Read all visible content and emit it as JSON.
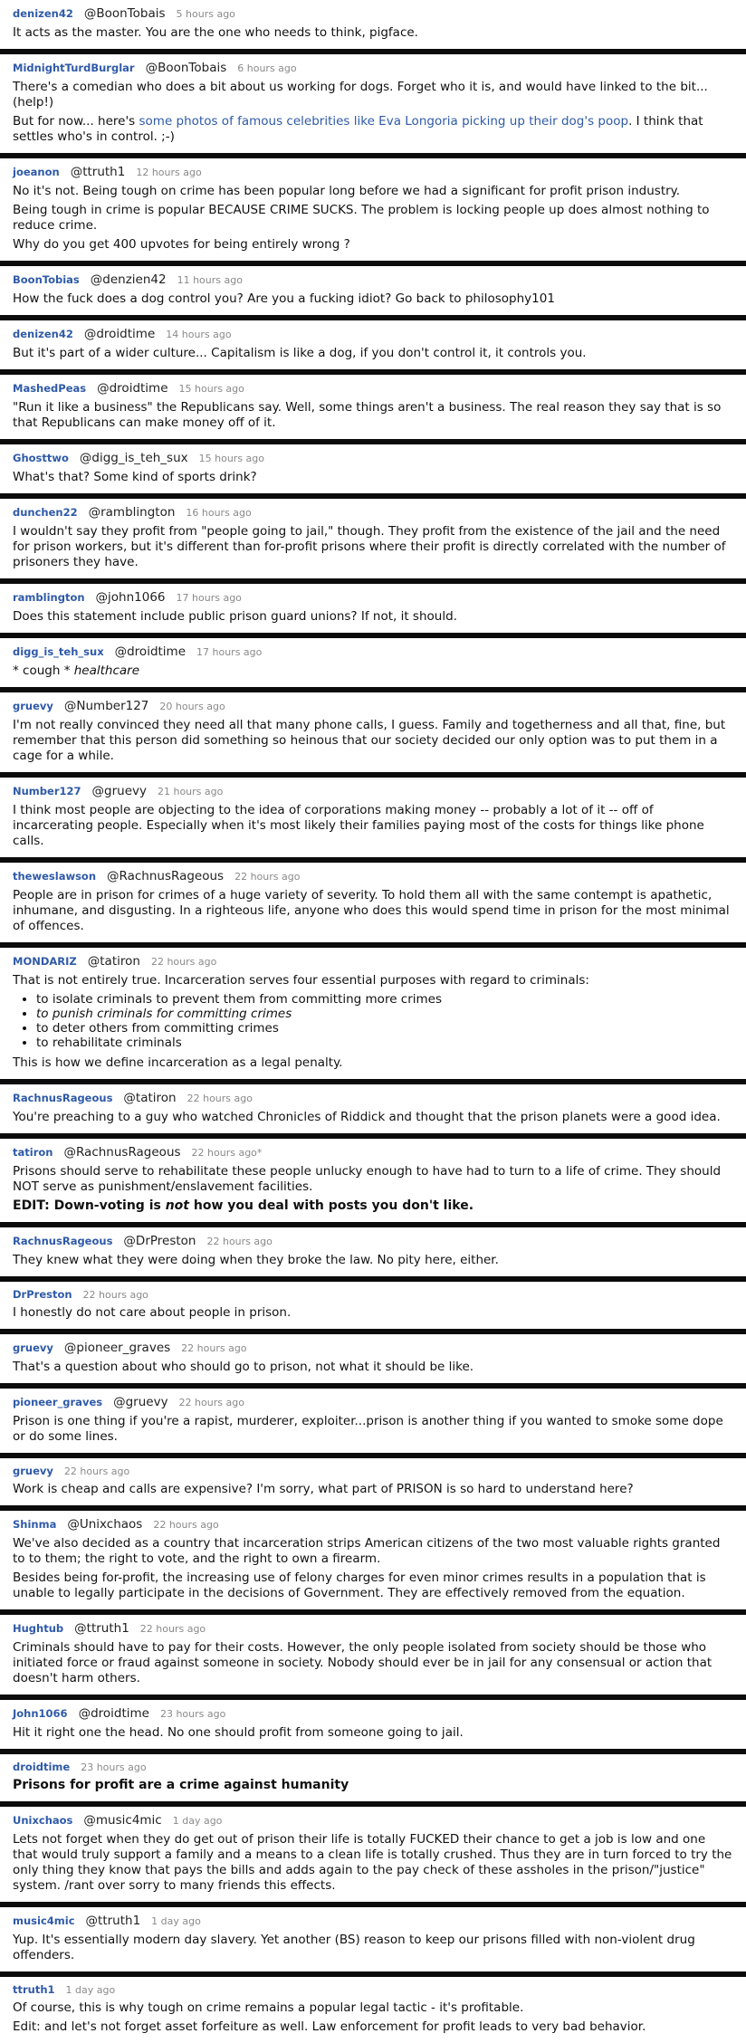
{
  "comments": [
    {
      "user": "denizen42",
      "reply_to": "@BoonTobais",
      "time": "5 hours ago",
      "paras": [
        {
          "text": "It acts as the master. You are the one who needs to think, pigface."
        }
      ]
    },
    {
      "user": "MidnightTurdBurglar",
      "reply_to": "@BoonTobais",
      "time": "6 hours ago",
      "paras": [
        {
          "text": "There's a comedian who does a bit about us working for dogs. Forget who it is, and would have linked to the bit... (help!)"
        },
        {
          "pre": "But for now... here's ",
          "link": "some photos of famous celebrities like Eva Longoria picking up their dog's poop",
          "post": ". I think that settles who's in control. ;-)"
        }
      ]
    },
    {
      "user": "joeanon",
      "reply_to": "@ttruth1",
      "time": "12 hours ago",
      "paras": [
        {
          "text": "No it's not. Being tough on crime has been popular long before we had a significant for profit prison industry."
        },
        {
          "text": "Being tough in crime is popular BECAUSE CRIME SUCKS. The problem is locking people up does almost nothing to reduce crime."
        },
        {
          "text": "Why do you get 400 upvotes for being entirely wrong ?"
        }
      ]
    },
    {
      "user": "BoonTobias",
      "reply_to": "@denzien42",
      "time": "11 hours ago",
      "paras": [
        {
          "text": "How the fuck does a dog control you? Are you a fucking idiot? Go back to philosophy101"
        }
      ]
    },
    {
      "user": "denizen42",
      "reply_to": "@droidtime",
      "time": "14 hours ago",
      "paras": [
        {
          "text": "But it's part of a wider culture... Capitalism is like a dog, if you don't control it, it controls you."
        }
      ]
    },
    {
      "user": "MashedPeas",
      "reply_to": "@droidtime",
      "time": "15 hours ago",
      "paras": [
        {
          "text": "\"Run it like a business\" the Republicans say. Well, some things aren't a business. The real reason they say that is so that Republicans can make money off of it."
        }
      ]
    },
    {
      "user": "Ghosttwo",
      "reply_to": "@digg_is_teh_sux",
      "time": "15 hours ago",
      "paras": [
        {
          "text": "What's that? Some kind of sports drink?"
        }
      ]
    },
    {
      "user": "dunchen22",
      "reply_to": "@ramblington",
      "time": "16 hours ago",
      "paras": [
        {
          "text": "I wouldn't say they profit from \"people going to jail,\" though. They profit from the existence of the jail and the need for prison workers, but it's different than for-profit prisons where their profit is directly correlated with the number of prisoners they have."
        }
      ]
    },
    {
      "user": "ramblington",
      "reply_to": "@john1066",
      "time": "17 hours ago",
      "paras": [
        {
          "text": "Does this statement include public prison guard unions? If not, it should."
        }
      ]
    },
    {
      "user": "digg_is_teh_sux",
      "reply_to": "@droidtime",
      "time": "17 hours ago",
      "paras": [
        {
          "pre": "* cough * ",
          "em": "healthcare"
        }
      ]
    },
    {
      "user": "gruevy",
      "reply_to": "@Number127",
      "time": "20 hours ago",
      "paras": [
        {
          "text": "I'm not really convinced they need all that many phone calls, I guess. Family and togetherness and all that, fine, but remember that this person did something so heinous that our society decided our only option was to put them in a cage for a while."
        }
      ]
    },
    {
      "user": "Number127",
      "reply_to": "@gruevy",
      "time": "21 hours ago",
      "paras": [
        {
          "text": "I think most people are objecting to the idea of corporations making money -- probably a lot of it -- off of incarcerating people. Especially when it's most likely their families paying most of the costs for things like phone calls."
        }
      ]
    },
    {
      "user": "theweslawson",
      "reply_to": "@RachnusRageous",
      "time": "22 hours ago",
      "paras": [
        {
          "text": "People are in prison for crimes of a huge variety of severity. To hold them all with the same contempt is apathetic, inhumane, and disgusting. In a righteous life, anyone who does this would spend time in prison for the most minimal of offences."
        }
      ]
    },
    {
      "user": "MONDARIZ",
      "reply_to": "@tatiron",
      "time": "22 hours ago",
      "paras": [
        {
          "text": "That is not entirely true. Incarceration serves four essential purposes with regard to criminals:"
        }
      ],
      "list": [
        {
          "text": "to isolate criminals to prevent them from committing more crimes",
          "italic": false
        },
        {
          "text": "to punish criminals for committing crimes",
          "italic": true
        },
        {
          "text": "to deter others from committing crimes",
          "italic": false
        },
        {
          "text": "to rehabilitate criminals",
          "italic": false
        }
      ],
      "after": [
        {
          "text": "This is how we define incarceration as a legal penalty."
        }
      ]
    },
    {
      "user": "RachnusRageous",
      "reply_to": "@tatiron",
      "time": "22 hours ago",
      "paras": [
        {
          "text": "You're preaching to a guy who watched Chronicles of Riddick and thought that the prison planets were a good idea."
        }
      ]
    },
    {
      "user": "tatiron",
      "reply_to": "@RachnusRageous",
      "time": "22 hours ago*",
      "paras": [
        {
          "text": "Prisons should serve to rehabilitate these people unlucky enough to have had to turn to a life of crime. They should NOT serve as punishment/enslavement facilities."
        },
        {
          "bold": true,
          "pre": "EDIT: Down-voting is ",
          "em": "not",
          "post": " how you deal with posts you don't like."
        }
      ]
    },
    {
      "user": "RachnusRageous",
      "reply_to": "@DrPreston",
      "time": "22 hours ago",
      "paras": [
        {
          "text": "They knew what they were doing when they broke the law. No pity here, either."
        }
      ]
    },
    {
      "user": "DrPreston",
      "reply_to": "",
      "time": "22 hours ago",
      "paras": [
        {
          "text": "I honestly do not care about people in prison."
        }
      ]
    },
    {
      "user": "gruevy",
      "reply_to": "@pioneer_graves",
      "time": "22 hours ago",
      "paras": [
        {
          "text": "That's a question about who should go to prison, not what it should be like."
        }
      ]
    },
    {
      "user": "pioneer_graves",
      "reply_to": "@gruevy",
      "time": "22 hours ago",
      "paras": [
        {
          "text": "Prison is one thing if you're a rapist, murderer, exploiter...prison is another thing if you wanted to smoke some dope or do some lines."
        }
      ]
    },
    {
      "user": "gruevy",
      "reply_to": "",
      "time": "22 hours ago",
      "paras": [
        {
          "text": "Work is cheap and calls are expensive? I'm sorry, what part of PRISON is so hard to understand here?"
        }
      ]
    },
    {
      "user": "Shinma",
      "reply_to": "@Unixchaos",
      "time": "22 hours ago",
      "paras": [
        {
          "text": "We've also decided as a country that incarceration strips American citizens of the two most valuable rights granted to to them; the right to vote, and the right to own a firearm."
        },
        {
          "text": "Besides being for-profit, the increasing use of felony charges for even minor crimes results in a population that is unable to legally participate in the decisions of Government. They are effectively removed from the equation."
        }
      ]
    },
    {
      "user": "Hughtub",
      "reply_to": "@ttruth1",
      "time": "22 hours ago",
      "paras": [
        {
          "text": "Criminals should have to pay for their costs. However, the only people isolated from society should be those who initiated force or fraud against someone in society. Nobody should ever be in jail for any consensual or action that doesn't harm others."
        }
      ]
    },
    {
      "user": "John1066",
      "reply_to": "@droidtime",
      "time": "23 hours ago",
      "paras": [
        {
          "text": "Hit it right one the head. No one should profit from someone going to jail."
        }
      ]
    },
    {
      "user": "droidtime",
      "reply_to": "",
      "time": "23 hours ago",
      "paras": [
        {
          "bold": true,
          "text": "Prisons for profit are a crime against humanity"
        }
      ]
    },
    {
      "user": "Unixchaos",
      "reply_to": "@music4mic",
      "time": "1 day ago",
      "paras": [
        {
          "text": "Lets not forget when they do get out of prison their life is totally FUCKED their chance to get a job is low and one that would truly support a family and a means to a clean life is totally crushed. Thus they are in turn forced to try the only thing they know that pays the bills and adds again to the pay check of these assholes in the prison/\"justice\" system. /rant over sorry to many friends this effects."
        }
      ]
    },
    {
      "user": "music4mic",
      "reply_to": "@ttruth1",
      "time": "1 day ago",
      "paras": [
        {
          "text": "Yup. It's essentially modern day slavery. Yet another (BS) reason to keep our prisons filled with non-violent drug offenders."
        }
      ]
    },
    {
      "user": "ttruth1",
      "reply_to": "",
      "time": "1 day ago",
      "paras": [
        {
          "text": "Of course, this is why tough on crime remains a popular legal tactic - it's profitable."
        },
        {
          "text": "Edit: and let's not forget asset forfeiture as well. Law enforcement for profit leads to very bad behavior."
        }
      ]
    }
  ]
}
